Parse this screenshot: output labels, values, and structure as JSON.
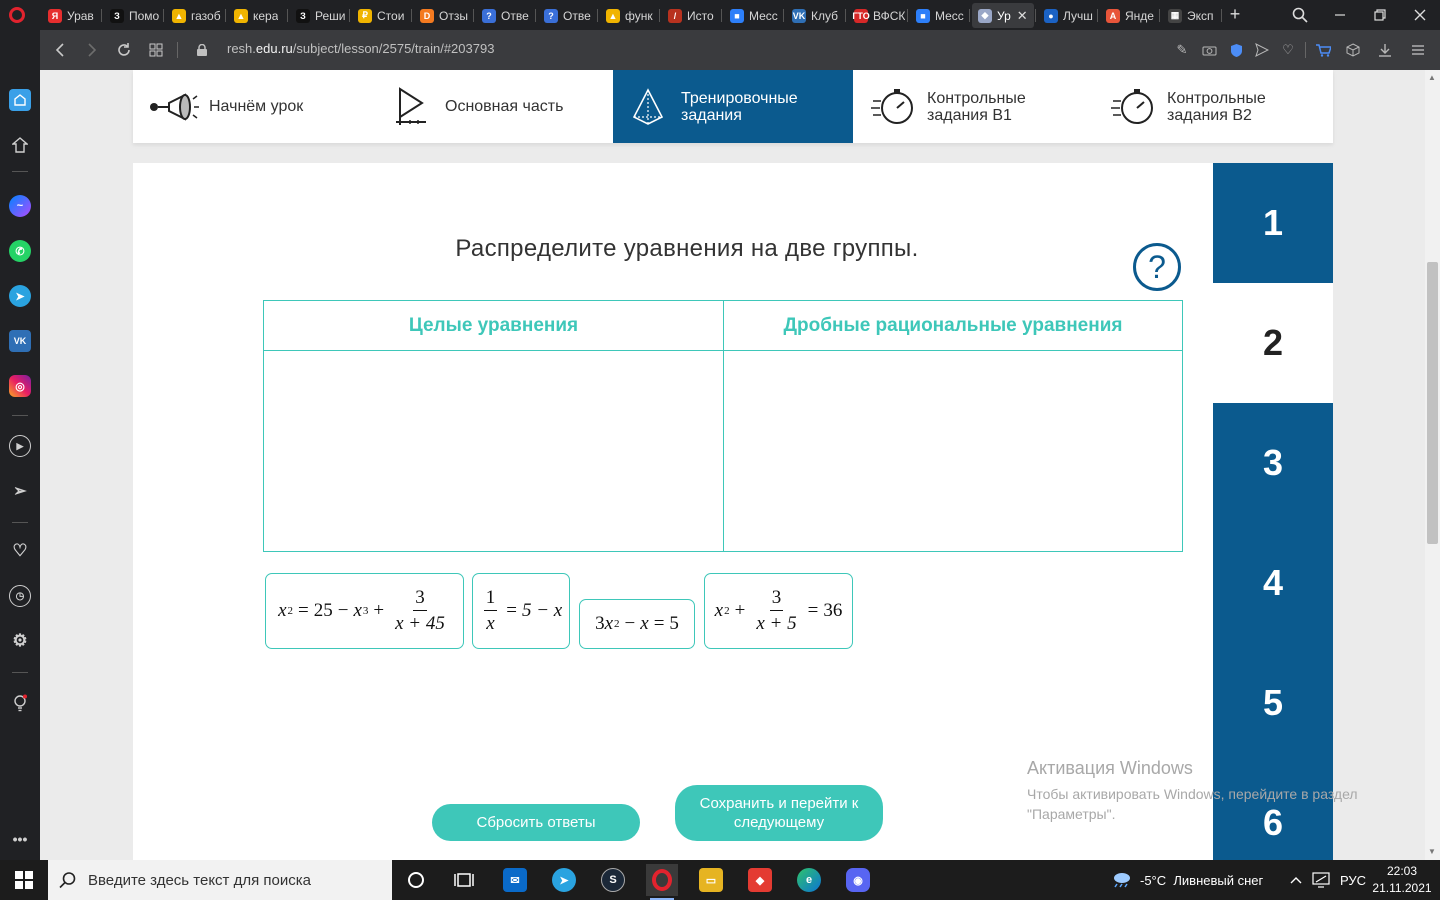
{
  "browser": {
    "tabs": [
      {
        "title": "Урав",
        "icon": "yandex-icon",
        "color": "#e62e2e",
        "glyph": "Я"
      },
      {
        "title": "Помо",
        "icon": "znanija-icon",
        "color": "#111111",
        "glyph": "З"
      },
      {
        "title": "газоб",
        "icon": "yandex-images-icon",
        "color": "#f0b400",
        "glyph": "▲"
      },
      {
        "title": "кера",
        "icon": "yandex-images-icon",
        "color": "#f0b400",
        "glyph": "▲"
      },
      {
        "title": "Реши",
        "icon": "znanija-icon",
        "color": "#111111",
        "glyph": "З"
      },
      {
        "title": "Стои",
        "icon": "coin-icon",
        "color": "#f0b400",
        "glyph": "₽"
      },
      {
        "title": "Отзы",
        "icon": "dns-icon",
        "color": "#f47a20",
        "glyph": "D"
      },
      {
        "title": "Отве",
        "icon": "question-icon",
        "color": "#3a6fd8",
        "glyph": "?"
      },
      {
        "title": "Отве",
        "icon": "question-icon",
        "color": "#3a6fd8",
        "glyph": "?"
      },
      {
        "title": "функ",
        "icon": "yandex-images-icon",
        "color": "#f0b400",
        "glyph": "▲"
      },
      {
        "title": "Исто",
        "icon": "history-icon",
        "color": "#b8321f",
        "glyph": "/"
      },
      {
        "title": "Месс",
        "icon": "messenger-icon",
        "color": "#2d7ff9",
        "glyph": "■"
      },
      {
        "title": "Клуб",
        "icon": "vk-icon",
        "color": "#2f6fb5",
        "glyph": "VK"
      },
      {
        "title": "ВФСК",
        "icon": "gto-icon",
        "color": "#d62828",
        "glyph": "ГТО"
      },
      {
        "title": "Месс",
        "icon": "messenger-icon",
        "color": "#2d7ff9",
        "glyph": "■"
      },
      {
        "title": "Ур",
        "icon": "resh-icon",
        "color": "#9aa7c7",
        "glyph": "◆",
        "active": true
      },
      {
        "title": "Лучш",
        "icon": "blue-site-icon",
        "color": "#1b62c4",
        "glyph": "●"
      },
      {
        "title": "Янде",
        "icon": "yandex-translate-icon",
        "color": "#e8553a",
        "glyph": "A"
      },
      {
        "title": "Эксп",
        "icon": "grid-icon",
        "color": "#444444",
        "glyph": "▦"
      }
    ],
    "url_prefix": "resh.",
    "url_domain": "edu.ru",
    "url_path": "/subject/lesson/2575/train/#203793"
  },
  "lesson_nav": [
    {
      "label": "Начнём урок",
      "icon": "megaphone-icon"
    },
    {
      "label": "Основная часть",
      "icon": "play-icon"
    },
    {
      "label": "Тренировочные\nзадания",
      "icon": "pyramid-icon",
      "active": true
    },
    {
      "label": "Контрольные\nзадания В1",
      "icon": "stopwatch-icon"
    },
    {
      "label": "Контрольные\nзадания В2",
      "icon": "stopwatch-icon"
    }
  ],
  "task": {
    "title": "Распределите уравнения на две группы.",
    "help_label": "?",
    "columns": [
      "Целые уравнения",
      "Дробные рациональные уравнения"
    ],
    "reset_label": "Сбросить ответы",
    "save_label": "Сохранить и перейти к следующему"
  },
  "equations": {
    "eq1": {
      "a": "x",
      "a_exp": "2",
      "eq": "=",
      "b": "25",
      "minus": "−",
      "c": "x",
      "c_exp": "3",
      "plus": "+",
      "num": "3",
      "den": "x + 45"
    },
    "eq2": {
      "num": "1",
      "den": "x",
      "eq": "=",
      "rhs": "5 − x"
    },
    "eq3": {
      "coef": "3",
      "var": "x",
      "exp": "2",
      "minus": "−",
      "var2": "x",
      "eq": "=",
      "rhs": "5"
    },
    "eq4": {
      "a": "x",
      "a_exp": "2",
      "plus": "+",
      "num": "3",
      "den": "x + 5",
      "eq": "=",
      "rhs": "36"
    }
  },
  "task_numbers": [
    "1",
    "2",
    "3",
    "4",
    "5",
    "6"
  ],
  "current_task": "2",
  "activation": {
    "title": "Активация Windows",
    "line1": "Чтобы активировать Windows, перейдите в раздел",
    "line2": "\"Параметры\"."
  },
  "taskbar": {
    "search_placeholder": "Введите здесь текст для поиска",
    "weather": "-5°C  Ливневый снег",
    "lang": "РУС",
    "time": "22:03",
    "date": "21.11.2021"
  },
  "colors": {
    "brand_blue": "#0b5a8e",
    "accent_teal": "#3ec7b9"
  }
}
